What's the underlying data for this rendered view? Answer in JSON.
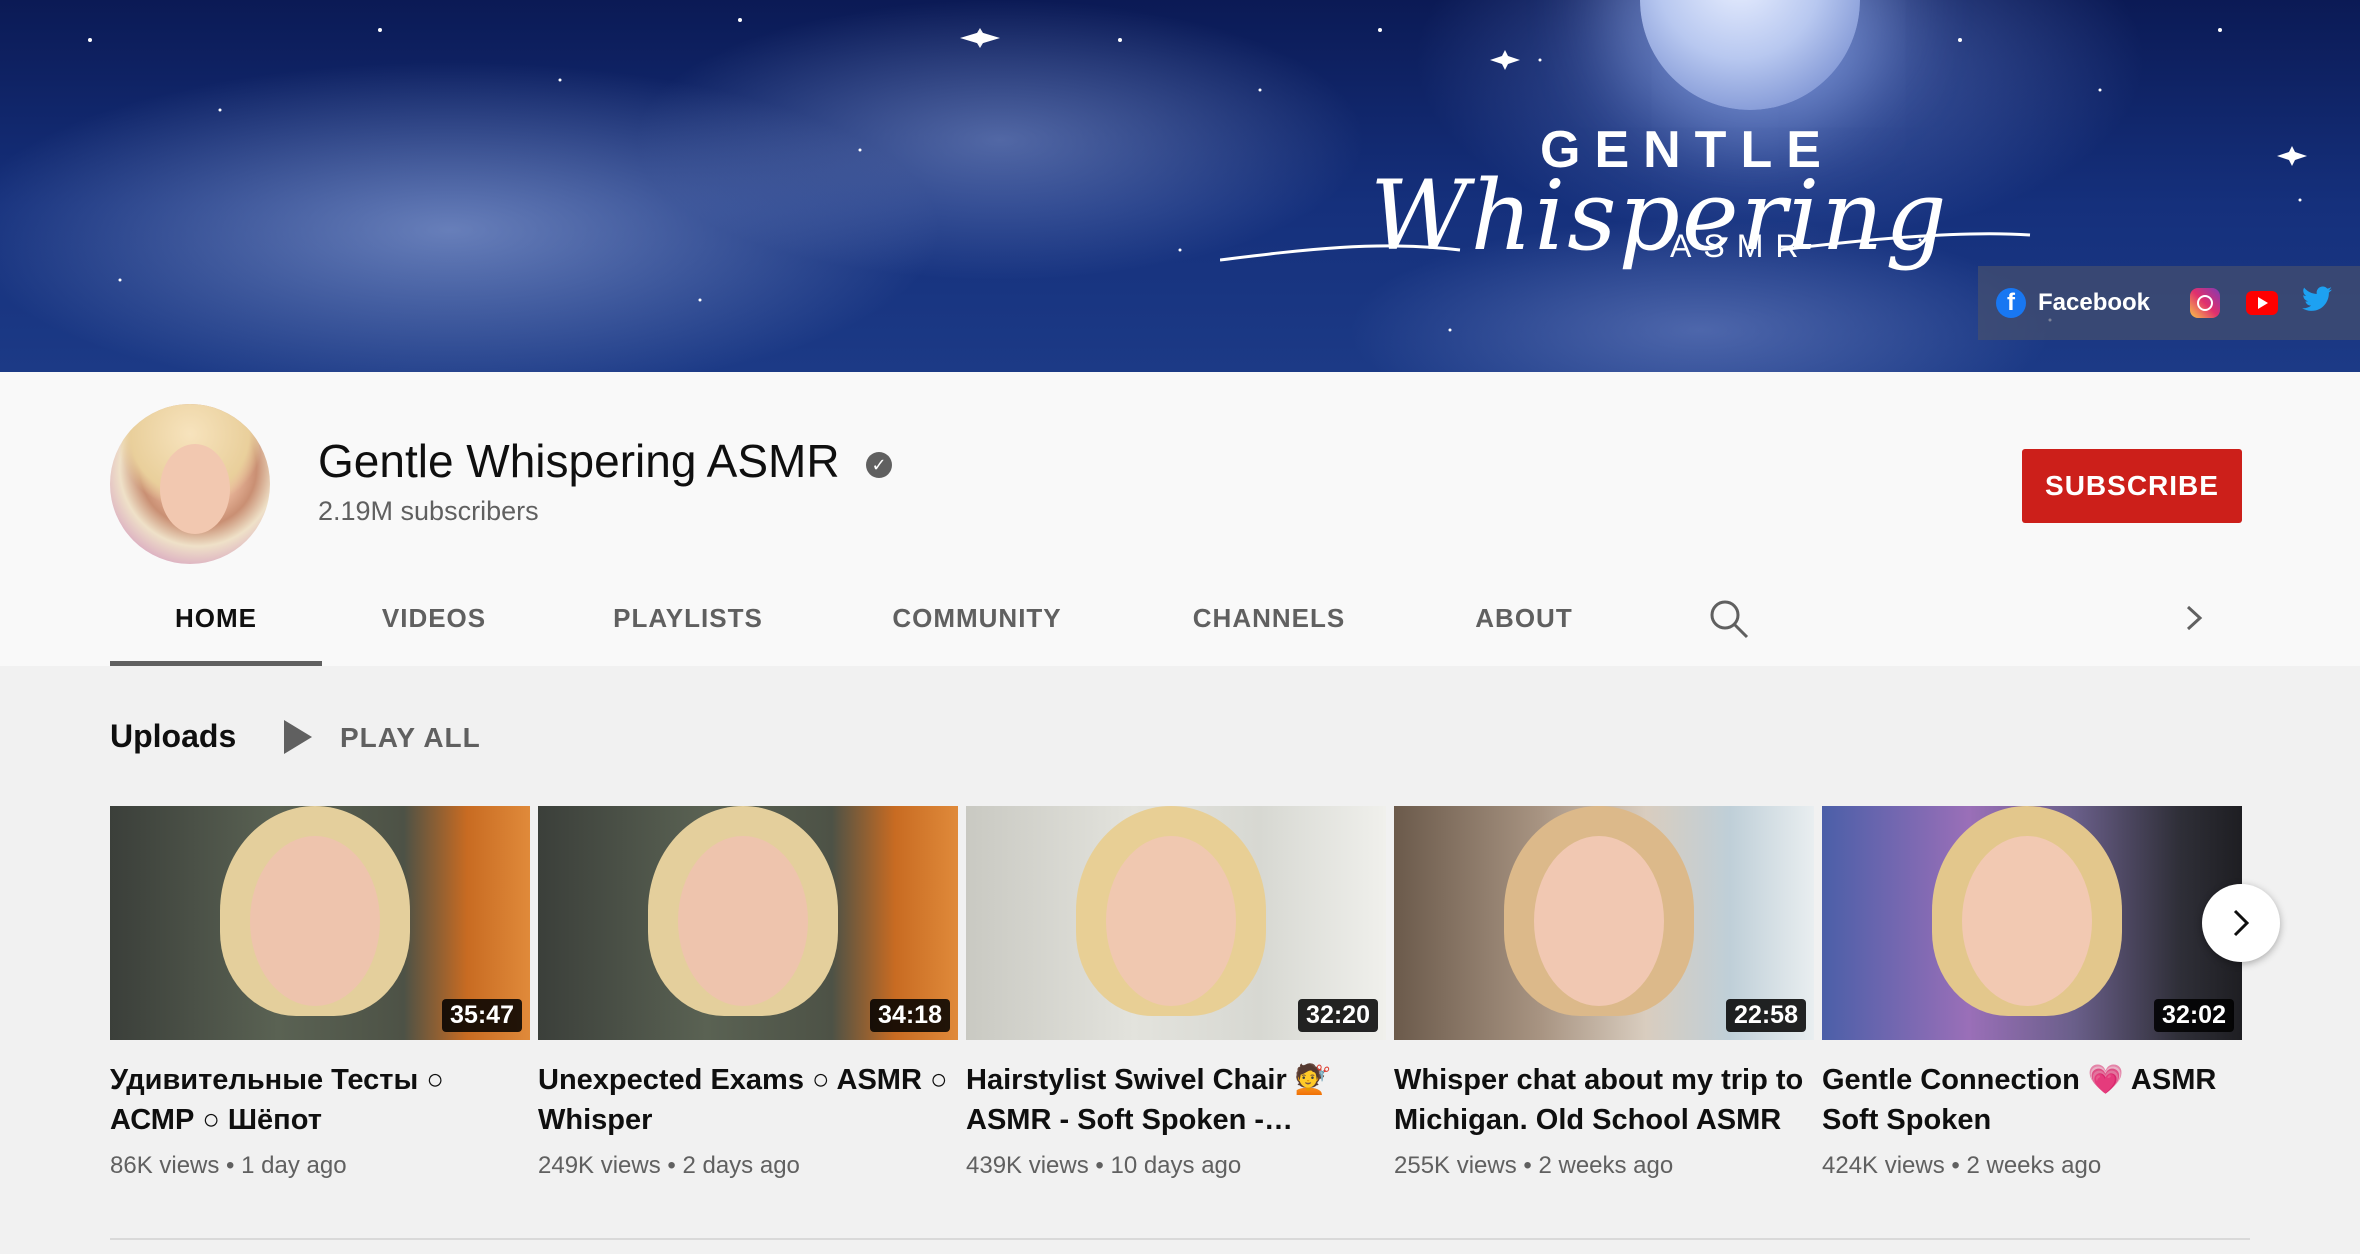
{
  "banner": {
    "logo_top": "GENTLE",
    "logo_script": "Whispering",
    "logo_bottom": "ASMR",
    "social": {
      "facebook_label": "Facebook",
      "icons": [
        "facebook-icon",
        "instagram-icon",
        "youtube-icon",
        "twitter-icon"
      ]
    }
  },
  "channel": {
    "name": "Gentle Whispering ASMR",
    "subscribers": "2.19M subscribers",
    "verified_glyph": "✓",
    "subscribe_label": "SUBSCRIBE"
  },
  "tabs": [
    {
      "label": "HOME",
      "active": true
    },
    {
      "label": "VIDEOS",
      "active": false
    },
    {
      "label": "PLAYLISTS",
      "active": false
    },
    {
      "label": "COMMUNITY",
      "active": false
    },
    {
      "label": "CHANNELS",
      "active": false
    },
    {
      "label": "ABOUT",
      "active": false
    }
  ],
  "uploads": {
    "title": "Uploads",
    "play_all": "PLAY ALL",
    "videos": [
      {
        "title": "Удивительные Тесты ○ АСМР ○ Шёпот",
        "duration": "35:47",
        "meta": "86K views • 1 day ago"
      },
      {
        "title": "Unexpected Exams ○ ASMR ○ Whisper",
        "duration": "34:18",
        "meta": "249K views • 2 days ago"
      },
      {
        "title": "Hairstylist Swivel Chair 💇 ASMR - Soft Spoken -…",
        "duration": "32:20",
        "meta": "439K views • 10 days ago"
      },
      {
        "title": "Whisper chat about my trip to Michigan. Old School ASMR",
        "duration": "22:58",
        "meta": "255K views • 2 weeks ago"
      },
      {
        "title": "Gentle Connection 💗 ASMR Soft Spoken",
        "duration": "32:02",
        "meta": "424K views • 2 weeks ago"
      }
    ]
  },
  "colors": {
    "subscribe_bg": "#cc1f1a",
    "text_primary": "#0f0f0f",
    "text_secondary": "#606060",
    "page_bg": "#f1f1f1"
  }
}
